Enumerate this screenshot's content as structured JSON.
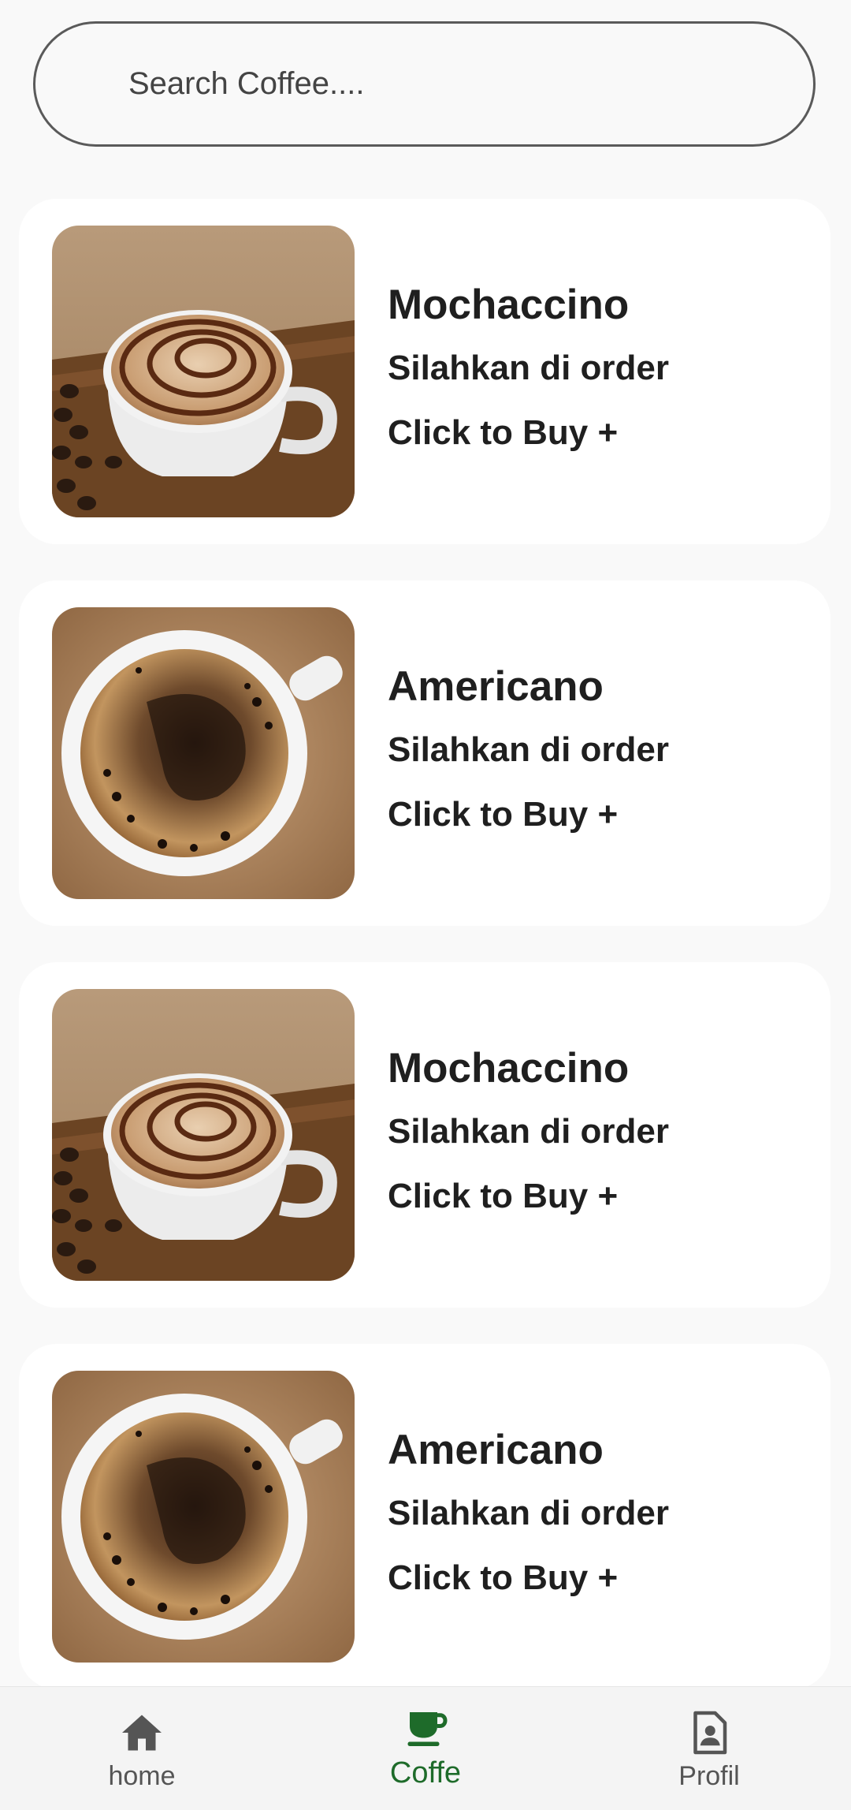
{
  "search": {
    "placeholder": "Search Coffee...."
  },
  "products": [
    {
      "name": "Mochaccino",
      "subtitle": "Silahkan di order",
      "buy_label": "Click to Buy +",
      "image": "mochaccino-cup-photo"
    },
    {
      "name": "Americano",
      "subtitle": "Silahkan di order",
      "buy_label": "Click to Buy +",
      "image": "americano-cup-photo"
    },
    {
      "name": "Mochaccino",
      "subtitle": "Silahkan di order",
      "buy_label": "Click to Buy +",
      "image": "mochaccino-cup-photo"
    },
    {
      "name": "Americano",
      "subtitle": "Silahkan di order",
      "buy_label": "Click to Buy +",
      "image": "americano-cup-photo"
    }
  ],
  "bottom_nav": {
    "items": [
      {
        "label": "home",
        "icon": "home-icon",
        "active": false
      },
      {
        "label": "Coffe",
        "icon": "coffee-cup-icon",
        "active": true
      },
      {
        "label": "Profil",
        "icon": "profile-document-icon",
        "active": false
      }
    ]
  },
  "colors": {
    "background": "#f9f9f9",
    "card": "#ffffff",
    "accent_active": "#1e6b2a",
    "inactive_icon": "#555555",
    "text": "#1f1f1f"
  }
}
